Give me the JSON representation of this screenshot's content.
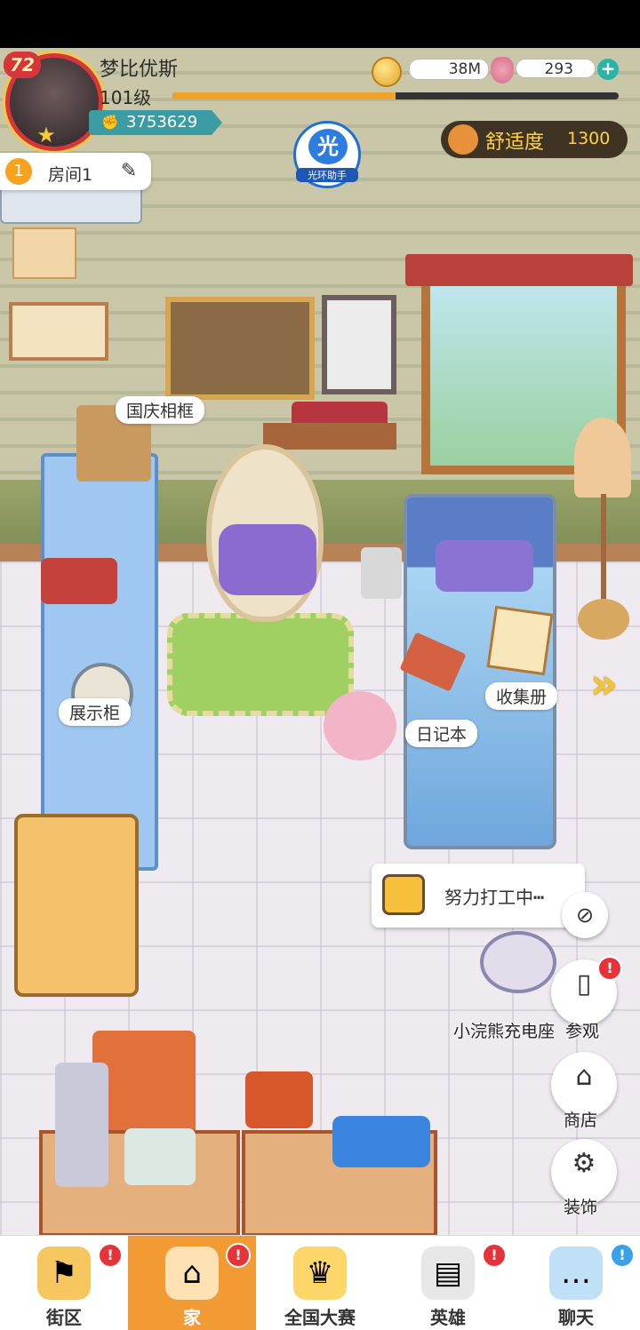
{
  "player": {
    "name": "梦比优斯",
    "level": "101级",
    "avatar_level": "72",
    "power": "3753629",
    "xp_fraction": 0.5
  },
  "currency": {
    "coins": "38M",
    "gems": "293",
    "plus_label": "+"
  },
  "comfort": {
    "label": "舒适度",
    "value": "1300"
  },
  "helper": {
    "badge": "光",
    "label": "光环助手"
  },
  "room": {
    "number": "1",
    "name": "房间1"
  },
  "furniture_labels": {
    "frame": "国庆相框",
    "cabinet": "展示柜",
    "collection": "收集册",
    "diary": "日记本"
  },
  "task": {
    "text": "努力打工中┅"
  },
  "robot_label": "小浣熊充电座",
  "side_buttons": {
    "visit": "参观",
    "shop": "商店",
    "decorate": "装饰"
  },
  "nav": [
    {
      "label": "街区",
      "icon": "signpost-icon",
      "badge": "!"
    },
    {
      "label": "家",
      "icon": "house-icon",
      "badge": "!",
      "active": true
    },
    {
      "label": "全国大赛",
      "icon": "trophy-icon"
    },
    {
      "label": "英雄",
      "icon": "cards-icon",
      "badge": "!"
    },
    {
      "label": "聊天",
      "icon": "chat-icon",
      "badge": "!"
    }
  ],
  "colors": {
    "accent": "#f29a34",
    "badge_red": "#e8323a",
    "comfort_gold": "#ffd34a"
  }
}
